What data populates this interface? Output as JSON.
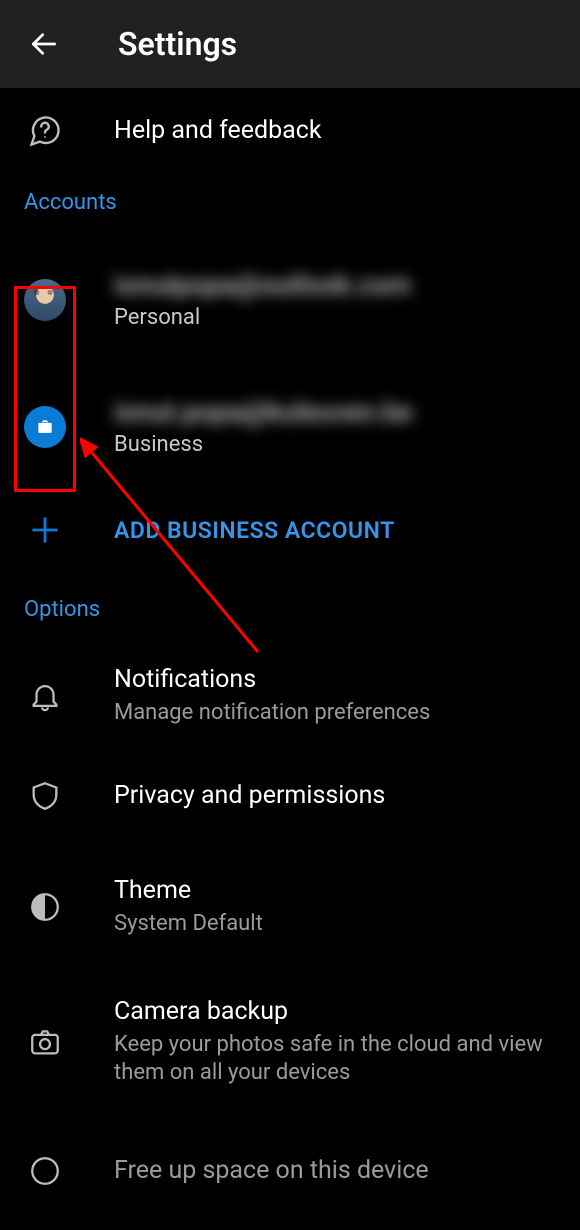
{
  "header": {
    "title": "Settings"
  },
  "help": {
    "label": "Help and feedback"
  },
  "sections": {
    "accounts": "Accounts",
    "options": "Options"
  },
  "accounts": [
    {
      "email": "ionutpopa@outlook.com",
      "type": "Personal"
    },
    {
      "email": "ionut.popa@kuleuven.be",
      "type": "Business"
    }
  ],
  "add_account": {
    "label": "ADD BUSINESS ACCOUNT"
  },
  "options": {
    "notifications": {
      "title": "Notifications",
      "sub": "Manage notification preferences"
    },
    "privacy": {
      "title": "Privacy and permissions"
    },
    "theme": {
      "title": "Theme",
      "sub": "System Default"
    },
    "camera": {
      "title": "Camera backup",
      "sub": "Keep your photos safe in the cloud and view them on all your devices"
    },
    "freeup": {
      "title": "Free up space on this device"
    }
  }
}
